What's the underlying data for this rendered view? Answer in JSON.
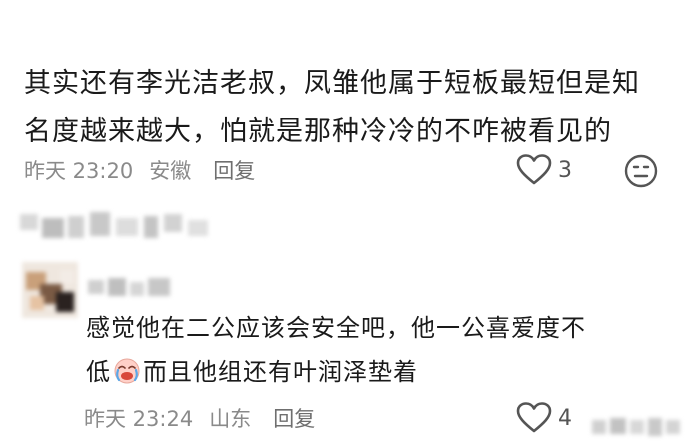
{
  "comment1": {
    "line1": "其实还有李光洁老叔，凤雏他属于短板最短但是知",
    "line2": "名度越来越大，怕就是那种冷冷的不咋被看见的",
    "time": "昨天 23:20",
    "location": "安徽",
    "reply_label": "回复",
    "like_count": "3"
  },
  "reply": {
    "line1": "感觉他在二公应该会安全吧，他一公喜爱度不",
    "line2_before_emoji": "低",
    "line2_after_emoji": "而且他组还有叶润泽垫着",
    "time": "昨天 23:24",
    "location": "山东",
    "reply_label": "回复",
    "like_count": "4"
  },
  "colors": {
    "text": "#1a1a1a",
    "meta": "#8a8a8a",
    "icon": "#555555"
  },
  "icons": {
    "like": "heart-outline-icon",
    "emoji_reaction": "smiley-face-icon",
    "inline_emoji": "crying-laugh-emoji-icon"
  }
}
